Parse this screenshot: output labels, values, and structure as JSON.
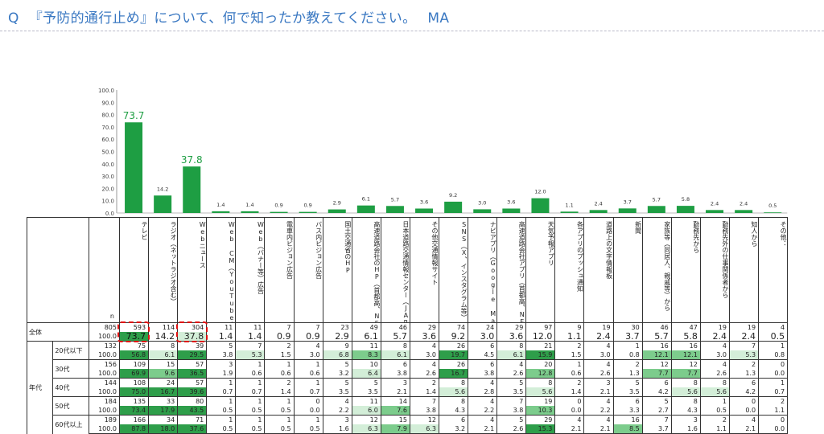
{
  "question": {
    "q": "Q",
    "text": "『予防的通行止め』について、何で知ったか教えてください。",
    "type": "MA"
  },
  "colors": {
    "bar": "#1e9e43",
    "top_value": "#1e9e43",
    "shade_high": "#2e9e4a",
    "shade_mid": "#7ccc8c",
    "shade_low": "#d3eed8",
    "highlight": "#e01010",
    "title": "#3a78c2"
  },
  "chart_data": {
    "type": "bar",
    "categories": [
      "テレビ",
      "ラジオ（ネットラジオ含む）",
      "Webニュース",
      "Web CM（YouTube広告等）",
      "Web（バナー等）広告",
      "電車内ビジョン広告",
      "バス内ビジョン広告",
      "国土交通省のHP",
      "高速道路会社のHP（首都高、NEXCO）",
      "日本道路交通情報センター（JARTIC）HP",
      "その他交通情報サイト",
      "SNS（X、インスタグラム等）",
      "ナビアプリ（Google Map、ナビタイムアプリ等）",
      "高速道路会社アプリ（首都高、NEXCO）",
      "天気予報アプリ",
      "各アプリのプッシュ通知",
      "道路上の文字情報板",
      "新聞",
      "家族等（同居人、親戚等）から",
      "勤務先から",
      "勤務先外の仕事関係者から",
      "知人から",
      "その他："
    ],
    "values": [
      73.7,
      14.2,
      37.8,
      1.4,
      1.4,
      0.9,
      0.9,
      2.9,
      6.1,
      5.7,
      3.6,
      9.2,
      3.0,
      3.6,
      12.0,
      1.1,
      2.4,
      3.7,
      5.7,
      5.8,
      2.4,
      2.4,
      0.5
    ],
    "value_labels": [
      "73.7",
      "14.2",
      "37.8",
      "1.4",
      "1.4",
      "0.9",
      "0.9",
      "2.9",
      "6.1",
      "5.7",
      "3.6",
      "9.2",
      "3.0",
      "3.6",
      "12.0",
      "1.1",
      "2.4",
      "3.7",
      "5.7",
      "5.8",
      "2.4",
      "2.4",
      "0.5"
    ],
    "ylim": [
      0,
      100
    ],
    "yticks": [
      "0.0",
      "10.0",
      "20.0",
      "30.0",
      "40.0",
      "50.0",
      "60.0",
      "70.0",
      "80.0",
      "90.0",
      "100.0"
    ],
    "title": "",
    "xlabel": "",
    "ylabel": ""
  },
  "table": {
    "n_header": "n",
    "headers": [
      "テレビ",
      "ラジオ（ネットラジオ含む）",
      "Webニュース",
      "Web CM（YouTube広告等）",
      "Web（バナー等）広告",
      "電車内ビジョン広告",
      "バス内ビジョン広告",
      "国土交通省のHP",
      "高速道路会社のHP（首都高、NEXCO）",
      "日本道路交通情報センター（JARTIC）HP",
      "その他交通情報サイト",
      "SNS（X、インスタグラム等）",
      "ナビアプリ（Google Map、ナビタイムアプリ等）",
      "高速道路会社アプリ（首都高、NEXCO）",
      "天気予報アプリ",
      "各アプリのプッシュ通知",
      "道路上の文字情報板",
      "新聞",
      "家族等（同居人、親戚等）から",
      "勤務先から",
      "勤務先外の仕事関係者から",
      "知人から",
      "その他："
    ],
    "group_label": "年代",
    "rows": [
      {
        "label": "全体",
        "n": "805",
        "pct": "100.0",
        "counts": [
          "593",
          "114",
          "304",
          "11",
          "11",
          "7",
          "7",
          "23",
          "49",
          "46",
          "29",
          "74",
          "24",
          "29",
          "97",
          "9",
          "19",
          "30",
          "46",
          "47",
          "19",
          "19",
          "4"
        ],
        "pcts": [
          "73.7",
          "14.2",
          "37.8",
          "1.4",
          "1.4",
          "0.9",
          "0.9",
          "2.9",
          "6.1",
          "5.7",
          "3.6",
          "9.2",
          "3.0",
          "3.6",
          "12.0",
          "1.1",
          "2.4",
          "3.7",
          "5.7",
          "5.8",
          "2.4",
          "2.4",
          "0.5"
        ]
      },
      {
        "label": "20代以下",
        "n": "132",
        "pct": "100.0",
        "counts": [
          "75",
          "8",
          "39",
          "5",
          "7",
          "2",
          "4",
          "9",
          "11",
          "8",
          "4",
          "26",
          "6",
          "8",
          "21",
          "2",
          "4",
          "1",
          "16",
          "16",
          "4",
          "7",
          "1"
        ],
        "pcts": [
          "56.8",
          "6.1",
          "29.5",
          "3.8",
          "5.3",
          "1.5",
          "3.0",
          "6.8",
          "8.3",
          "6.1",
          "3.0",
          "19.7",
          "4.5",
          "6.1",
          "15.9",
          "1.5",
          "3.0",
          "0.8",
          "12.1",
          "12.1",
          "3.0",
          "5.3",
          "0.8"
        ]
      },
      {
        "label": "30代",
        "n": "156",
        "pcts": [
          "69.9",
          "9.6",
          "36.5",
          "1.9",
          "0.6",
          "0.6",
          "0.6",
          "3.2",
          "6.4",
          "3.8",
          "2.6",
          "16.7",
          "3.8",
          "2.6",
          "12.8",
          "0.6",
          "2.6",
          "1.3",
          "7.7",
          "7.7",
          "2.6",
          "1.3",
          "0.0"
        ],
        "pct": "100.0",
        "counts": [
          "109",
          "15",
          "57",
          "3",
          "1",
          "1",
          "1",
          "5",
          "10",
          "6",
          "4",
          "26",
          "6",
          "4",
          "20",
          "1",
          "4",
          "2",
          "12",
          "12",
          "4",
          "2",
          "0"
        ]
      },
      {
        "label": "40代",
        "n": "144",
        "pct": "100.0",
        "counts": [
          "108",
          "24",
          "57",
          "1",
          "1",
          "2",
          "1",
          "5",
          "5",
          "3",
          "2",
          "8",
          "4",
          "5",
          "8",
          "2",
          "3",
          "5",
          "6",
          "8",
          "8",
          "6",
          "1"
        ],
        "pcts": [
          "75.0",
          "16.7",
          "39.6",
          "0.7",
          "0.7",
          "1.4",
          "0.7",
          "3.5",
          "3.5",
          "2.1",
          "1.4",
          "5.6",
          "2.8",
          "3.5",
          "5.6",
          "1.4",
          "2.1",
          "3.5",
          "4.2",
          "5.6",
          "5.6",
          "4.2",
          "0.7"
        ]
      },
      {
        "label": "50代",
        "n": "184",
        "pct": "100.0",
        "counts": [
          "135",
          "33",
          "80",
          "1",
          "1",
          "1",
          "0",
          "4",
          "11",
          "14",
          "7",
          "8",
          "4",
          "7",
          "19",
          "0",
          "4",
          "6",
          "5",
          "8",
          "1",
          "0",
          "2"
        ],
        "pcts": [
          "73.4",
          "17.9",
          "43.5",
          "0.5",
          "0.5",
          "0.5",
          "0.0",
          "2.2",
          "6.0",
          "7.6",
          "3.8",
          "4.3",
          "2.2",
          "3.8",
          "10.3",
          "0.0",
          "2.2",
          "3.3",
          "2.7",
          "4.3",
          "0.5",
          "0.0",
          "1.1"
        ]
      },
      {
        "label": "60代以上",
        "n": "189",
        "pct": "100.0",
        "counts": [
          "166",
          "34",
          "71",
          "1",
          "1",
          "1",
          "1",
          "3",
          "12",
          "15",
          "12",
          "6",
          "4",
          "5",
          "29",
          "4",
          "4",
          "16",
          "7",
          "3",
          "2",
          "4",
          "0"
        ],
        "pcts": [
          "87.8",
          "18.0",
          "37.6",
          "0.5",
          "0.5",
          "0.5",
          "0.5",
          "1.6",
          "6.3",
          "7.9",
          "6.3",
          "3.2",
          "2.1",
          "2.6",
          "15.3",
          "2.1",
          "2.1",
          "8.5",
          "3.7",
          "1.6",
          "1.1",
          "2.1",
          "0.0"
        ]
      }
    ]
  }
}
